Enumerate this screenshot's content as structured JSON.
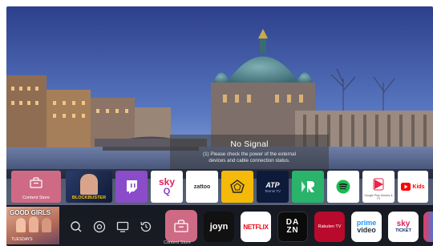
{
  "popup": {
    "title": "No Signal",
    "message_line1": "(1) Please check the power of the external",
    "message_line2": "devices and cable connection status."
  },
  "row1": {
    "content_store_label": "Content Store",
    "blockbuster_label": "BLOCKBUSTER",
    "sky_text": "sky",
    "sky_sub": "Q",
    "zattoo_text": "zattoo",
    "atp_text": "ATP",
    "atp_sub": "Tennis TV",
    "google_play_label": "Google Play Movies & TV",
    "youtube_kids_text": "Kids"
  },
  "dock": {
    "featured_title": "GOOD GIRLS",
    "featured_sub": "TUESDAYS",
    "content_store_label": "Content Store",
    "joyn_text": "joyn",
    "netflix_text": "NETFLIX",
    "dazn_top": "DA",
    "dazn_bottom": "ZN",
    "rakuten_text": "Rakuten TV",
    "prime_top": "prime",
    "prime_bottom": "video",
    "skyticket_top": "sky",
    "skyticket_bottom": "TICKET"
  },
  "colors": {
    "content_store_tile": "#cf6a84",
    "twitch": "#8a4cc9",
    "yellow_tile": "#f5b90a",
    "hbo_green": "#29b36b",
    "netflix_red": "#e50914",
    "rakuten": "#b80a2c"
  }
}
